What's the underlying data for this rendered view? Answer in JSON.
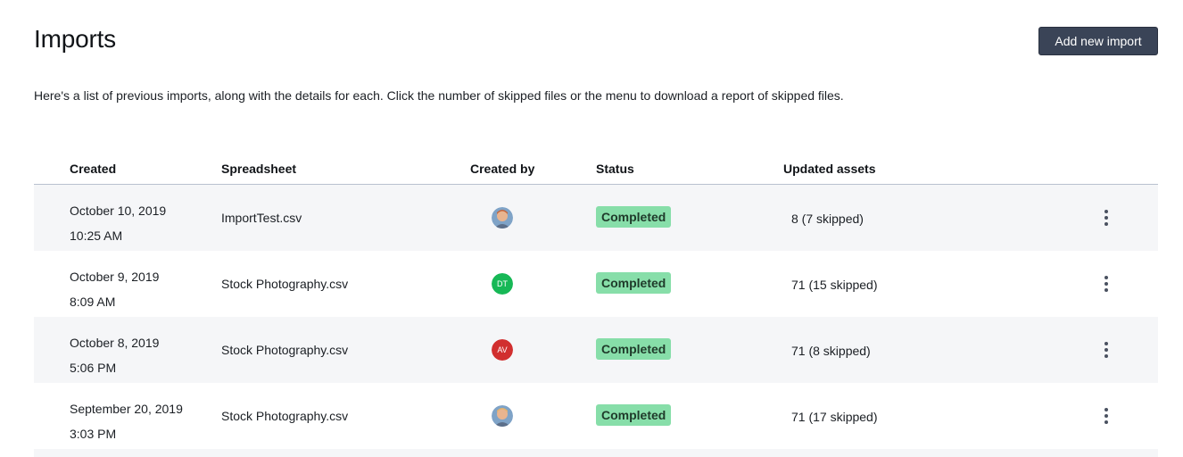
{
  "header": {
    "title": "Imports",
    "add_button": "Add new import"
  },
  "description": "Here's a list of previous imports, along with the details for each. Click the number of skipped files or the menu to download a report of skipped files.",
  "table": {
    "columns": [
      "Created",
      "Spreadsheet",
      "Created by",
      "Status",
      "Updated assets"
    ],
    "rows": [
      {
        "date": "October 10, 2019",
        "time": "10:25 AM",
        "spreadsheet": "ImportTest.csv",
        "created_by": "",
        "avatar_type": "photo",
        "avatar_color": "#c4643a",
        "status": "Completed",
        "updated": "8 (7 skipped)"
      },
      {
        "date": "October 9, 2019",
        "time": "8:09 AM",
        "spreadsheet": "Stock Photography.csv",
        "created_by": "DT",
        "avatar_type": "initials",
        "avatar_color": "#17b856",
        "status": "Completed",
        "updated": "71 (15 skipped)"
      },
      {
        "date": "October 8, 2019",
        "time": "5:06 PM",
        "spreadsheet": "Stock Photography.csv",
        "created_by": "AV",
        "avatar_type": "initials",
        "avatar_color": "#d12f2f",
        "status": "Completed",
        "updated": "71 (8 skipped)"
      },
      {
        "date": "September 20, 2019",
        "time": "3:03 PM",
        "spreadsheet": "Stock Photography.csv",
        "created_by": "",
        "avatar_type": "photo",
        "avatar_color": "#e3b26a",
        "status": "Completed",
        "updated": "71 (17 skipped)"
      }
    ]
  },
  "colors": {
    "button_bg": "#3a4457",
    "status_badge": "#87dea9",
    "row_alt": "#f5f6f8"
  }
}
